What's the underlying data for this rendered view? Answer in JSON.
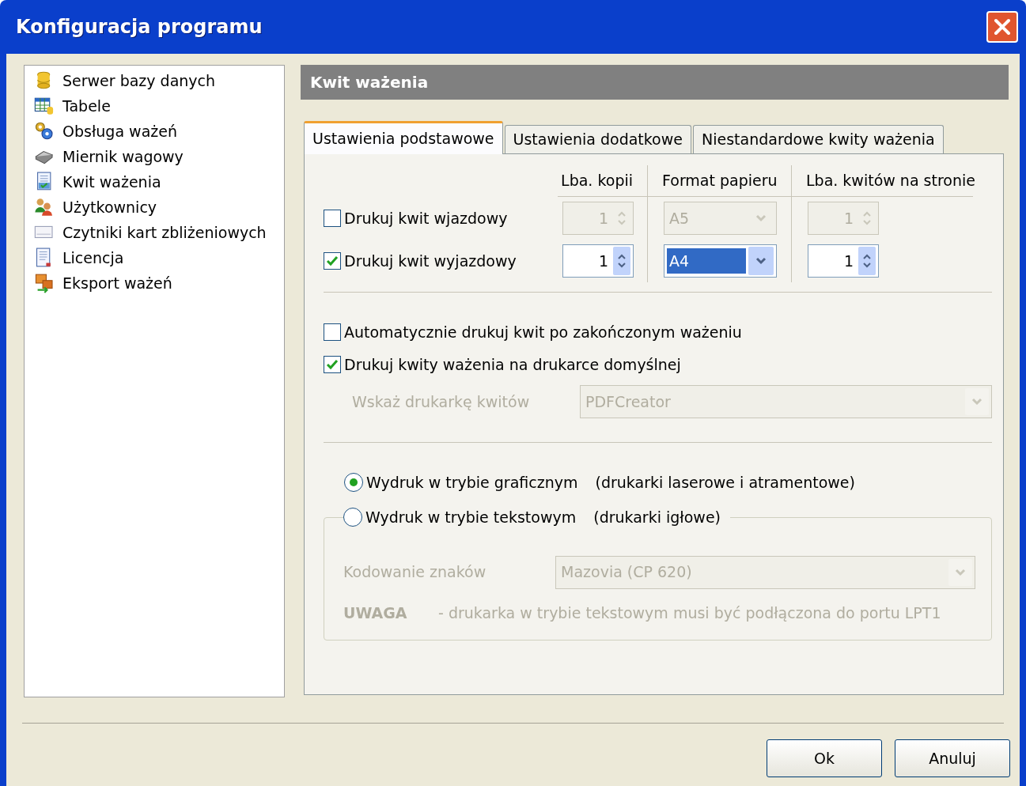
{
  "window": {
    "title": "Konfiguracja programu"
  },
  "sidebar": {
    "items": [
      {
        "label": "Serwer bazy danych",
        "selected": false
      },
      {
        "label": "Tabele",
        "selected": false
      },
      {
        "label": "Obsługa ważeń",
        "selected": false
      },
      {
        "label": "Miernik wagowy",
        "selected": false
      },
      {
        "label": "Kwit ważenia",
        "selected": false
      },
      {
        "label": "Użytkownicy",
        "selected": false
      },
      {
        "label": "Czytniki kart zbliżeniowych",
        "selected": false
      },
      {
        "label": "Licencja",
        "selected": false
      },
      {
        "label": "Eksport ważeń",
        "selected": false
      }
    ]
  },
  "panel": {
    "title": "Kwit ważenia"
  },
  "tabs": [
    {
      "label": "Ustawienia podstawowe",
      "selected": true
    },
    {
      "label": "Ustawienia dodatkowe",
      "selected": false
    },
    {
      "label": "Niestandardowe kwity ważenia",
      "selected": false
    }
  ],
  "print_table": {
    "columns": [
      "Lba. kopii",
      "Format papieru",
      "Lba. kwitów na stronie"
    ],
    "rows": [
      {
        "label": "Drukuj kwit wjazdowy",
        "checked": false,
        "copies": "1",
        "paper": "A5",
        "paper_highlighted": false,
        "per_page": "1"
      },
      {
        "label": "Drukuj kwit wyjazdowy",
        "checked": true,
        "copies": "1",
        "paper": "A4",
        "paper_highlighted": true,
        "per_page": "1"
      }
    ]
  },
  "options": [
    {
      "label": "Automatycznie drukuj kwit po zakończonym ważeniu",
      "checked": false
    },
    {
      "label": "Drukuj kwity ważenia na drukarce domyślnej",
      "checked": true
    }
  ],
  "printer": {
    "label": "Wskaż drukarkę kwitów",
    "value": "PDFCreator",
    "disabled": true
  },
  "modes": [
    {
      "label": "Wydruk w trybie graficznym",
      "note": "(drukarki laserowe i atramentowe)",
      "selected": true
    },
    {
      "label": "Wydruk w trybie tekstowym",
      "note": "(drukarki igłowe)",
      "selected": false
    }
  ],
  "encoding": {
    "label": "Kodowanie znaków",
    "value": "Mazovia (CP 620)",
    "disabled": true
  },
  "warning": {
    "label": "UWAGA",
    "text": "- drukarka w trybie tekstowym musi być podłączona do portu LPT1",
    "disabled": true
  },
  "buttons": [
    "Ok",
    "Anuluj"
  ]
}
